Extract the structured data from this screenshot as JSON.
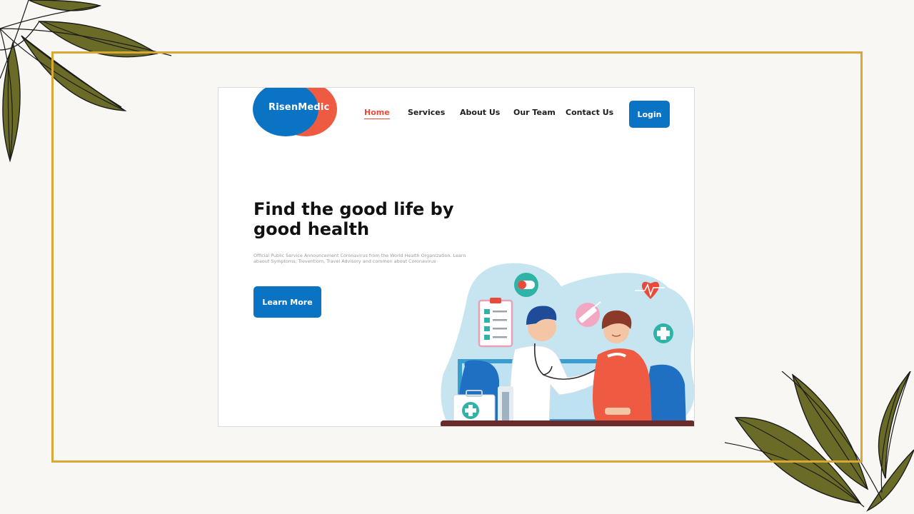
{
  "logo": {
    "text": "RisenMedic"
  },
  "nav": {
    "items": [
      {
        "label": "Home",
        "active": true
      },
      {
        "label": "Services"
      },
      {
        "label": "About Us"
      },
      {
        "label": "Our Team"
      },
      {
        "label": "Contact Us"
      }
    ],
    "login_label": "Login"
  },
  "hero": {
    "title": "Find the good life by good health",
    "description": "Official Public Service Announcement Coronavirus from the World Health Organization. Learn abaout Symptoms, Treventiom, Travel Advisory and common about Coronavirus",
    "cta_label": "Learn More"
  },
  "colors": {
    "primary_blue": "#0a73c4",
    "accent_red": "#ef5a43",
    "frame_gold": "#d8a832",
    "leaf_olive": "#6b6b28",
    "background": "#f8f7f3"
  },
  "icons": [
    "leaf-decoration",
    "clipboard-icon",
    "pill-icon",
    "syringe-icon",
    "heartbeat-icon",
    "medical-cross-icon",
    "first-aid-kit-icon"
  ]
}
